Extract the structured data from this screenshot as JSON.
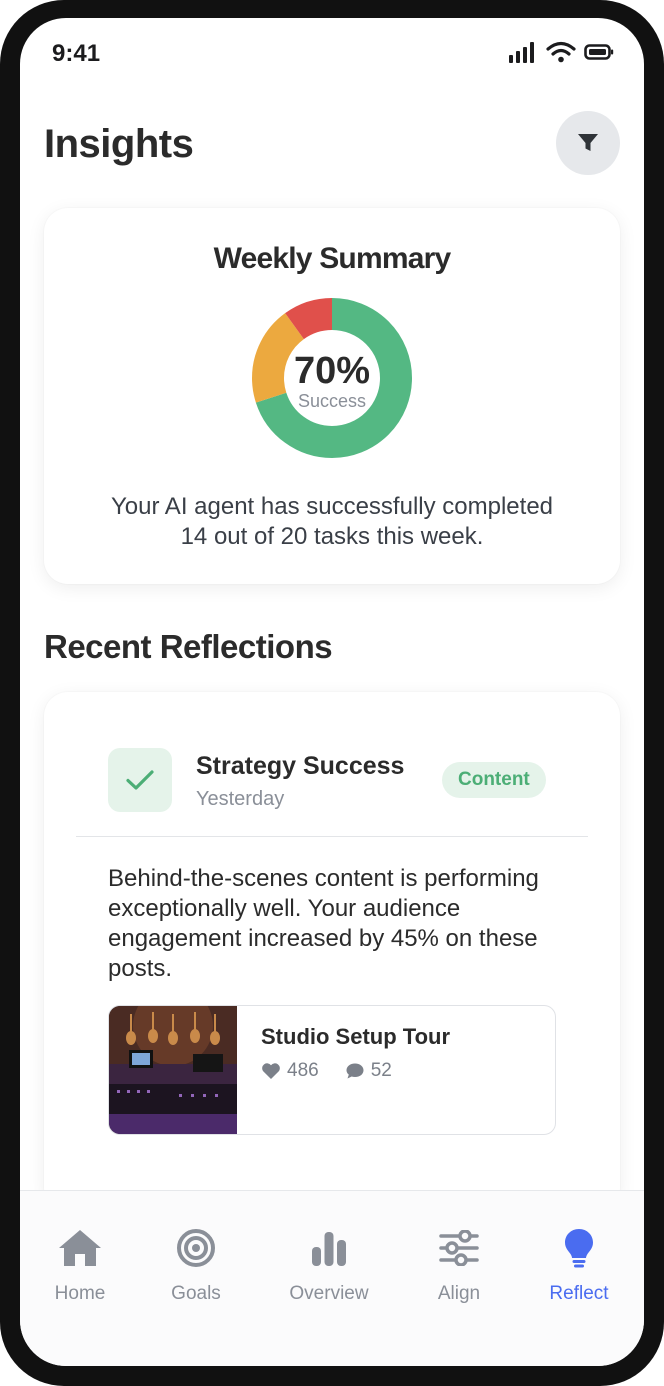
{
  "status_bar": {
    "time": "9:41"
  },
  "header": {
    "title": "Insights"
  },
  "summary": {
    "title": "Weekly Summary",
    "percent_text": "70%",
    "percent_label": "Success",
    "breakdown": {
      "success": 70,
      "partial": 20,
      "failed": 10
    },
    "colors": {
      "success": "#54b883",
      "partial": "#eca93f",
      "failed": "#e0504b"
    },
    "message_line1": "Your AI agent has successfully completed",
    "message_line2": "14 out of 20 tasks this week."
  },
  "reflections": {
    "section_title": "Recent Reflections",
    "items": [
      {
        "title": "Strategy Success",
        "time": "Yesterday",
        "tag": "Content",
        "body": "Behind-the-scenes content is performing exceptionally well. Your audience engagement increased by 45% on these posts.",
        "post": {
          "title": "Studio Setup Tour",
          "likes": "486",
          "comments": "52"
        }
      }
    ]
  },
  "tabbar": {
    "items": [
      {
        "label": "Home",
        "icon": "home-icon"
      },
      {
        "label": "Goals",
        "icon": "target-icon"
      },
      {
        "label": "Overview",
        "icon": "bar-chart-icon"
      },
      {
        "label": "Align",
        "icon": "sliders-icon"
      },
      {
        "label": "Reflect",
        "icon": "lightbulb-icon"
      }
    ],
    "active": "Reflect",
    "inactive_color": "#8a8f98",
    "active_color": "#4a6cf0"
  }
}
